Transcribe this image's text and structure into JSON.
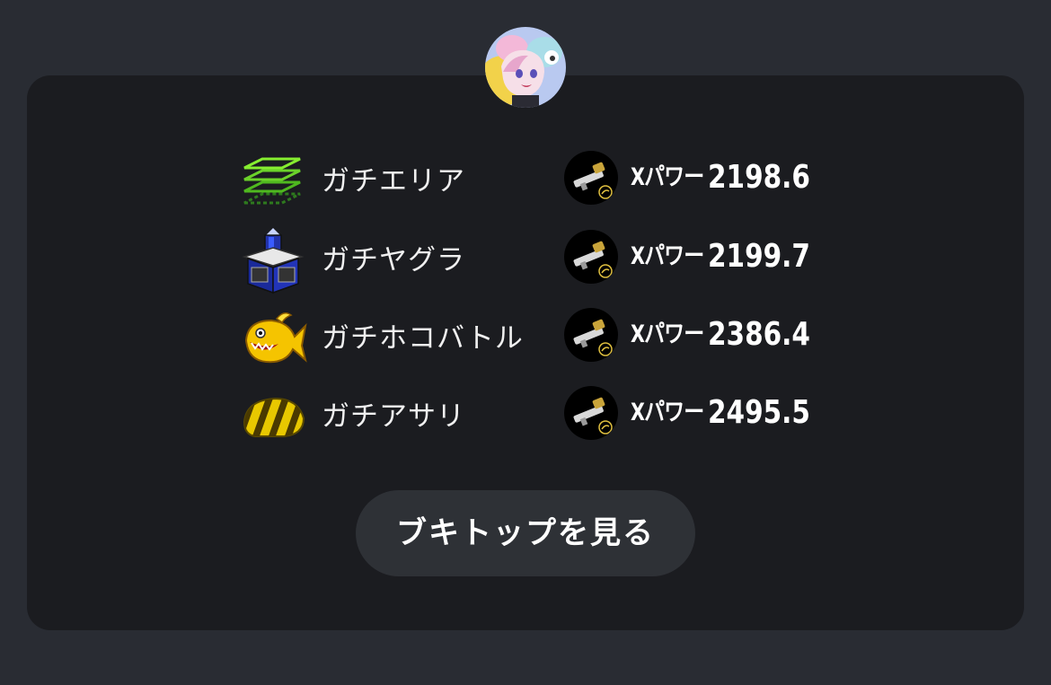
{
  "avatar": {
    "icon": "player-avatar-icon"
  },
  "rows": [
    {
      "mode": "ガチエリア",
      "mode_icon": "splat-zones-icon",
      "xp_label": "Xパワー",
      "xp_value": "2198.6",
      "weapon_icon": "weapon-icon"
    },
    {
      "mode": "ガチヤグラ",
      "mode_icon": "tower-control-icon",
      "xp_label": "Xパワー",
      "xp_value": "2199.7",
      "weapon_icon": "weapon-icon"
    },
    {
      "mode": "ガチホコバトル",
      "mode_icon": "rainmaker-icon",
      "xp_label": "Xパワー",
      "xp_value": "2386.4",
      "weapon_icon": "weapon-icon"
    },
    {
      "mode": "ガチアサリ",
      "mode_icon": "clam-blitz-icon",
      "xp_label": "Xパワー",
      "xp_value": "2495.5",
      "weapon_icon": "weapon-icon"
    }
  ],
  "cta": {
    "label": "ブキトップを見る"
  },
  "colors": {
    "page_bg": "#292c33",
    "card_bg": "#1b1c20",
    "button_bg": "#2e3136",
    "text": "#ffffff"
  }
}
